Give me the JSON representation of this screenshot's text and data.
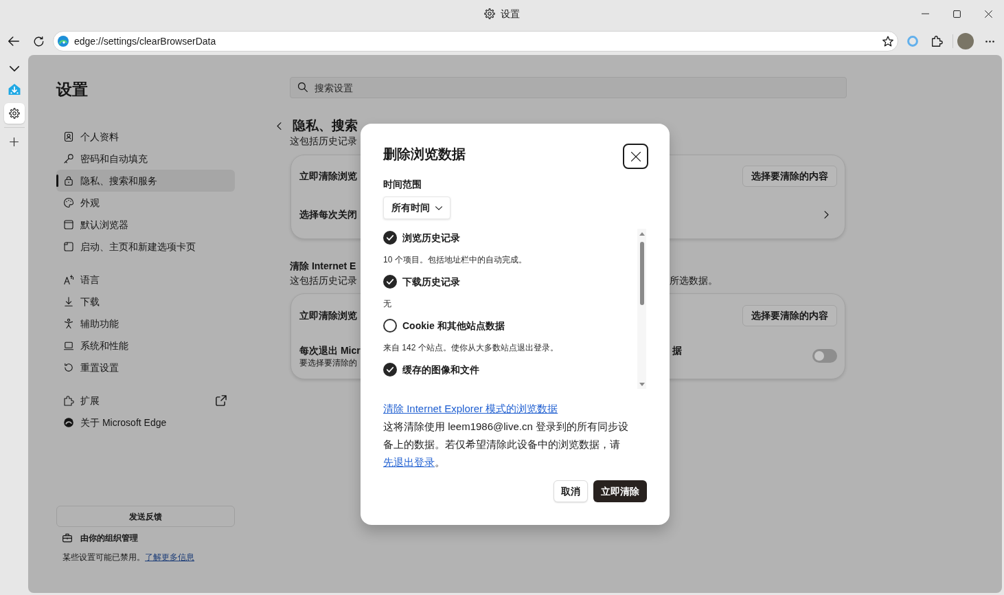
{
  "window": {
    "title": "设置"
  },
  "toolbar": {
    "address": "edge://settings/clearBrowserData"
  },
  "sidebar": {
    "title": "设置",
    "groups": [
      [
        {
          "label": "个人资料",
          "selected": false,
          "external": false
        },
        {
          "label": "密码和自动填充",
          "selected": false,
          "external": false
        },
        {
          "label": "隐私、搜索和服务",
          "selected": true,
          "external": false
        },
        {
          "label": "外观",
          "selected": false,
          "external": false
        },
        {
          "label": "默认浏览器",
          "selected": false,
          "external": false
        },
        {
          "label": "启动、主页和新建选项卡页",
          "selected": false,
          "external": false
        }
      ],
      [
        {
          "label": "语言",
          "selected": false,
          "external": false
        },
        {
          "label": "下载",
          "selected": false,
          "external": false
        },
        {
          "label": "辅助功能",
          "selected": false,
          "external": false
        },
        {
          "label": "系统和性能",
          "selected": false,
          "external": false
        },
        {
          "label": "重置设置",
          "selected": false,
          "external": false
        }
      ],
      [
        {
          "label": "扩展",
          "selected": false,
          "external": true
        },
        {
          "label": "关于 Microsoft Edge",
          "selected": false,
          "external": false
        }
      ]
    ],
    "feedback_button": "发送反馈",
    "managed_label": "由你的组织管理",
    "notice": {
      "text": "某些设置可能已禁用。",
      "link": "了解更多信息"
    }
  },
  "search": {
    "placeholder": "搜索设置"
  },
  "page": {
    "heading": "隐私、搜索",
    "sections": [
      {
        "description": "这包括历史记录",
        "card": [
          {
            "kind": "button",
            "label": "立即清除浏览",
            "button": "选择要清除的内容"
          },
          {
            "kind": "link",
            "label": "选择每次关闭"
          }
        ]
      },
      {
        "title": "清除 Internet E",
        "description": "这包括历史记录",
        "description_tail": "所选数据。",
        "card": [
          {
            "kind": "button",
            "label": "立即清除浏览",
            "button": "选择要清除的内容"
          },
          {
            "kind": "toggle",
            "label": "每次退出 Micr",
            "sublabel": "要选择要清除的",
            "label_tail": "据",
            "on": false
          }
        ]
      }
    ]
  },
  "dialog": {
    "title": "删除浏览数据",
    "time_range_label": "时间范围",
    "time_range": "所有时间",
    "options": [
      {
        "label": "浏览历史记录",
        "checked": true,
        "detail": "10 个项目。包括地址栏中的自动完成。"
      },
      {
        "label": "下载历史记录",
        "checked": true,
        "detail": "无"
      },
      {
        "label": "Cookie 和其他站点数据",
        "checked": false,
        "detail": "来自 142 个站点。使你从大多数站点退出登录。"
      },
      {
        "label": "缓存的图像和文件",
        "checked": true
      }
    ],
    "ie_link": "清除 Internet Explorer 模式的浏览数据",
    "sync_notice": {
      "text": "这将清除使用 leem1986@live.cn 登录到的所有同步设备上的数据。若仅希望清除此设备中的浏览数据，请",
      "link": "先退出登录",
      "after": "。"
    },
    "buttons": [
      {
        "label": "取消",
        "kind": "secondary"
      },
      {
        "label": "立即清除",
        "kind": "primary"
      }
    ]
  }
}
